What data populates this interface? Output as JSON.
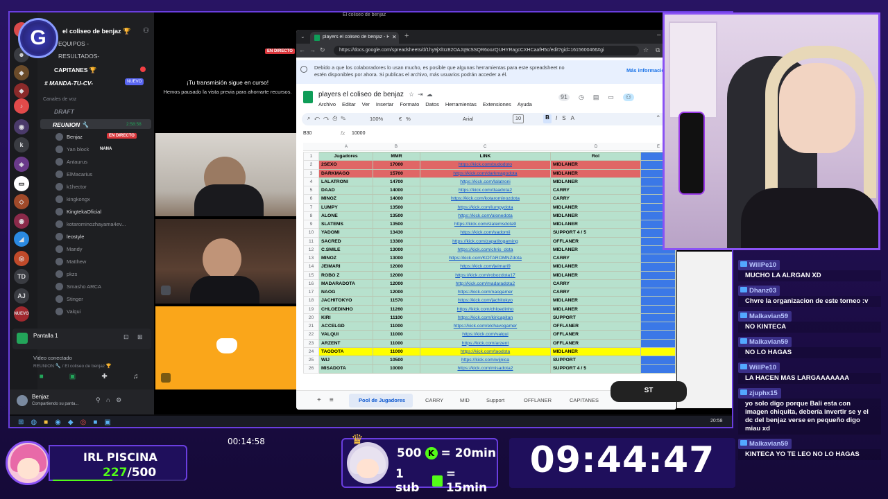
{
  "discord": {
    "server_name": "el coliseo de benjaz 🏆",
    "channels": [
      "EQUIPOS -",
      "RESULTADOS-",
      "CAPITANES 🏆",
      "MANDA-TU-CV-"
    ],
    "new_badge": "NUEVO",
    "category": "Canales de voz",
    "voice": [
      "DRAFT",
      "REUNION 🔧"
    ],
    "voice_time": "2:58:58",
    "live_badge": "EN DIRECTO",
    "users": [
      "Benjaz",
      "Yan block",
      "Antaurus",
      "ElMacarius",
      "k1hector",
      "kingkongx",
      "KingtekaOficial",
      "kotarominozhayama4ev...",
      "leostyle",
      "Mandy",
      "Matthew",
      "pkzs",
      "Smasho ARCA",
      "Stinger",
      "Valqui"
    ],
    "nana": "NANA",
    "nuevo": "NUEVO",
    "screen": "Pantalla 1",
    "video_status": "Video conectado",
    "video_sub": "REUNION 🔧 / El coliseo de benjaz 🏆",
    "me": "Benjaz",
    "me_status": "Compartiendo su panta...",
    "td": "TD",
    "aj": "AJ"
  },
  "stream": {
    "live_badge": "EN DIRECTO",
    "notice_title": "¡Tu transmisión sigue en curso!",
    "notice_body": "Hemos pausado la vista previa para ahorrarte recursos."
  },
  "browser": {
    "window_title": "El coliseo de benjaz",
    "tab_title": "players el coliseo de benjaz - Hoja",
    "url": "https://docs.google.com/spreadsheets/d/1hy9jXltrz82OAJq9cSSQR6oozQUHYRagcCXHCaafH5c/edit?gid=1615600466#gi",
    "banner": "Debido a que los colaboradores lo usan mucho, es posible que algunas herramientas para este spreadsheet no estén disponibles por ahora. Si publicas el archivo, más usuarios podrán acceder a él.",
    "banner_link": "Más información",
    "doc_title": "players el coliseo de benjaz",
    "menus": [
      "Archivo",
      "Editar",
      "Ver",
      "Insertar",
      "Formato",
      "Datos",
      "Herramientas",
      "Extensiones",
      "Ayuda"
    ],
    "zoom": "100%",
    "font": "Arial",
    "font_size": "10",
    "cell_ref": "B30",
    "cell_value": "10000",
    "col_letters": [
      "A",
      "B",
      "C",
      "D",
      "E"
    ],
    "headers": [
      "Jugadores",
      "MMR",
      "LINK",
      "Rol"
    ],
    "rows": [
      [
        "2SEXO",
        "17000",
        "https://kick.com/pudodoto",
        "MIDLANER",
        "r"
      ],
      [
        "DARKMAGO",
        "15700",
        "https://kick.com/darkmagodota",
        "MIDLANER",
        "r"
      ],
      [
        "LALATRONI",
        "14700",
        "https://kick.com/lalatroni",
        "MIDLANER",
        "g"
      ],
      [
        "DAAD",
        "14000",
        "https://kick.com/daadota2",
        "CARRY",
        "g"
      ],
      [
        "MINOZ",
        "14000",
        "https://kick.com/kotarominozdota",
        "CARRY",
        "g"
      ],
      [
        "LUMPY",
        "13500",
        "https://kick.com/lumpydota",
        "MIDLANER",
        "g"
      ],
      [
        "ALONE",
        "13500",
        "https://kick.com/alonedota",
        "MIDLANER",
        "g"
      ],
      [
        "SLATEMS",
        "13500",
        "https://kick.com/slatemsdota9",
        "MIDLANER",
        "g"
      ],
      [
        "YADOMI",
        "13430",
        "https://kick.com/yadomii",
        "SUPPORT 4 / 5",
        "g"
      ],
      [
        "SACRED",
        "13300",
        "https://kick.com/zapatitogaming",
        "OFFLANER",
        "g"
      ],
      [
        "C.SMILE",
        "13000",
        "https://kick.com/chris_dota",
        "MIDLANER",
        "g"
      ],
      [
        "MINOZ",
        "13000",
        "https://kick.com/KOTAROMNZdota",
        "CARRY",
        "g"
      ],
      [
        "JEIMARI",
        "12000",
        "https://kick.com/jeimari9",
        "MIDLANER",
        "g"
      ],
      [
        "ROBO Z",
        "12000",
        "https://kick.com/robozdota17",
        "MIDLANER",
        "g"
      ],
      [
        "MADARADOTA",
        "12000",
        "http://kick.com/madaradota2",
        "CARRY",
        "g"
      ],
      [
        "NAOG",
        "12000",
        "https://kick.com/naogamer",
        "CARRY",
        "g"
      ],
      [
        "JACHITOKYO",
        "11570",
        "https://kick.com/jachitokyo",
        "MIDLANER",
        "g"
      ],
      [
        "CHLOEDINHO",
        "11260",
        "https://kick.com/chloedinho",
        "MIDLANER",
        "g"
      ],
      [
        "KIRI",
        "11100",
        "https://kick.com/kiricapitan",
        "SUPPORT",
        "g"
      ],
      [
        "ACCELGD",
        "11000",
        "https://kick.com/elchavogamer",
        "OFFLANER",
        "g"
      ],
      [
        "VALQUI",
        "11000",
        "https://kick.com/valqui",
        "OFFLANER",
        "g"
      ],
      [
        "ARZENT",
        "11000",
        "https://kick.com/arzent",
        "OFFLANER",
        "g"
      ],
      [
        "TAODOTA",
        "11000",
        "https://kick.com/taodota",
        "MIDLANER",
        "y"
      ],
      [
        "WIJ",
        "10500",
        "https://kick.com/wijnica",
        "SUPPORT",
        "g"
      ],
      [
        "MISADOTA",
        "10000",
        "https://kick.com/misadota2",
        "SUPPORT 4 / 5",
        "g"
      ]
    ],
    "sheet_tabs": [
      "Pool de Jugadores",
      "CARRY",
      "MID",
      "Support",
      "OFFLANER",
      "CAPITANES"
    ],
    "taskbar_time": "20:58"
  },
  "chat": [
    {
      "user": "WillPe10",
      "text": "MUCHO LA ALRGAN XD"
    },
    {
      "user": "Dhanz03",
      "text": "Chvre la organizacion de este torneo :v"
    },
    {
      "user": "Malkavian59",
      "text": "NO KINTECA"
    },
    {
      "user": "Malkavian59",
      "text": "NO LO HAGAS"
    },
    {
      "user": "WillPe10",
      "text": "LA HACEN MAS LARGAAAAAAA"
    },
    {
      "user": "zjuphx15",
      "text": "yo solo digo porque Bali esta con imagen chiquita, debería invertir se y el dc del benjaz verse en pequeño digo miau xd"
    },
    {
      "user": "Malkavian59",
      "text": "KINTECA YO TE LEO NO LO HAGAS"
    }
  ],
  "overlay": {
    "irl_title": "IRL PISCINA",
    "irl_current": "227",
    "irl_total": "/500",
    "irl_progress": 0.454,
    "elapsed": "00:14:58",
    "sub1_amount": "500",
    "sub1_reward": "= 20min",
    "sub2_amount": "1 sub",
    "sub2_reward": "= 15min",
    "clock": "09:44:47"
  },
  "colors": {
    "accent": "#6a3ee0",
    "kick_green": "#53fc18",
    "clock_bg": "#1f0f5c"
  }
}
